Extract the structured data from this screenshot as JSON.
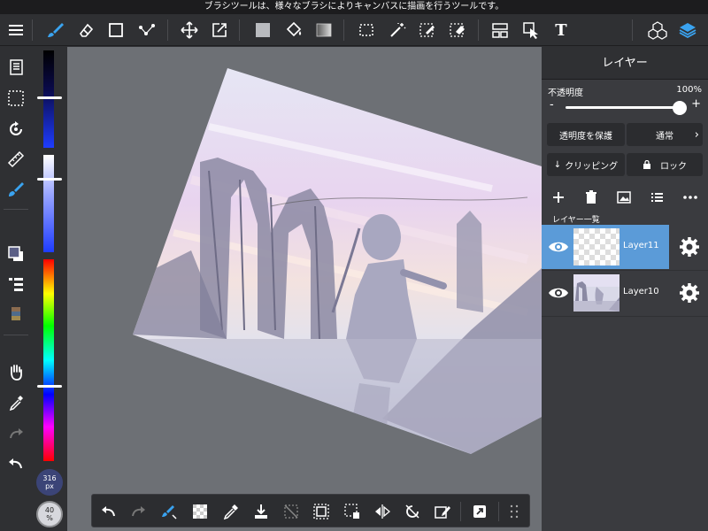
{
  "tooltip": {
    "text": "ブラシツールは、様々なブラシによりキャンバスに描画を行うツールです。"
  },
  "toolbar": {
    "menu_icon": "menu-icon",
    "tools": [
      "brush-icon",
      "eraser-icon",
      "shape-icon",
      "edit-icon",
      "move-icon",
      "transform-icon",
      "fill-icon",
      "bucket-icon",
      "gradient-icon",
      "select-rect-icon",
      "magic-wand-icon",
      "select-pen-icon",
      "select-eraser-icon",
      "panel-icon",
      "operation-icon",
      "text-icon",
      "material-icon",
      "layer-icon"
    ],
    "text_tool_label": "T"
  },
  "leftbar": {
    "items": [
      "layers-list-icon",
      "selection-icon",
      "rotate-icon",
      "ruler-icon",
      "brush-color-icon",
      "color-swatch-icon",
      "layer-menu-icon",
      "texture-icon",
      "hand-icon",
      "eyedropper-icon",
      "redo-icon",
      "undo-icon"
    ]
  },
  "brush": {
    "size_value": "316",
    "size_unit": "px",
    "opacity_value": "40",
    "opacity_unit": "%",
    "colors": {
      "accent": "#2e7dff",
      "hue_bar": "rainbow"
    }
  },
  "bottombar": {
    "items": [
      "undo-icon",
      "redo-icon",
      "brush-settings-icon",
      "transparent-icon",
      "eyedropper-icon",
      "import-icon",
      "clear-icon",
      "select-all-icon",
      "selection-transform-icon",
      "flip-icon",
      "rotate-icon",
      "edit-icon",
      "expand-icon",
      "grid-icon"
    ]
  },
  "panel": {
    "title": "レイヤー",
    "opacity_label": "不透明度",
    "opacity_value": "100%",
    "opacity_minus": "-",
    "opacity_plus": "+",
    "protect_alpha_label": "透明度を保護",
    "blend_mode_label": "通常",
    "clipping_label": "クリッピング",
    "lock_label": "ロック",
    "layer_list_label": "レイヤー一覧",
    "layers": [
      {
        "name": "Layer11",
        "selected": true
      },
      {
        "name": "Layer10",
        "selected": false
      }
    ]
  }
}
